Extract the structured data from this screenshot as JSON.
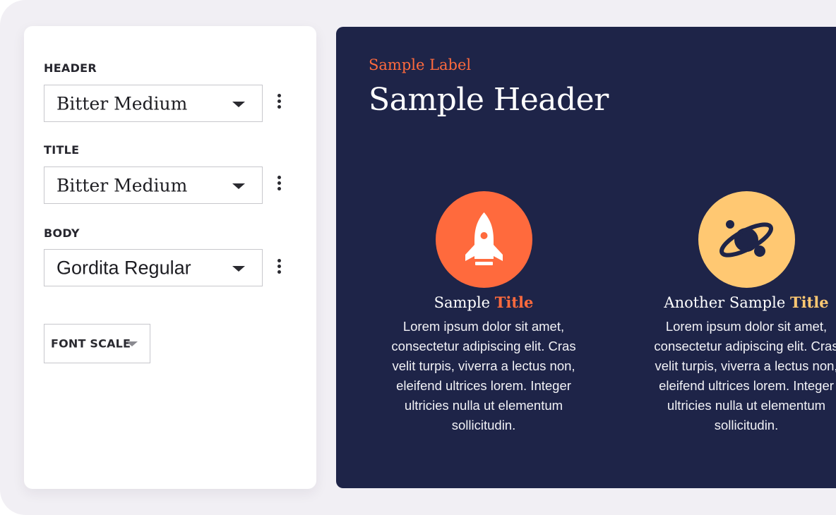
{
  "settings": {
    "header": {
      "label": "HEADER",
      "value": "Bitter Medium"
    },
    "title": {
      "label": "TITLE",
      "value": "Bitter Medium"
    },
    "body": {
      "label": "BODY",
      "value": "Gordita Regular"
    },
    "font_scale_label": "FONT SCALE"
  },
  "preview": {
    "label": "Sample Label",
    "header": "Sample Header",
    "features": [
      {
        "icon": "rocket-icon",
        "title_prefix": "Sample ",
        "title_highlight": "Title",
        "body": "Lorem ipsum dolor sit amet, consectetur adipiscing elit. Cras velit turpis, viverra a lectus non, eleifend ultrices lorem. Integer ultricies nulla ut elementum sollicitudin."
      },
      {
        "icon": "planet-icon",
        "title_prefix": "Another Sample ",
        "title_highlight": "Title",
        "body": "Lorem ipsum dolor sit amet, consectetur adipiscing elit. Cras velit turpis, viverra a lectus non, eleifend ultrices lorem. Integer ultricies nulla ut elementum sollicitudin."
      }
    ]
  },
  "colors": {
    "background": "#f1eff4",
    "preview_bg": "#1e2448",
    "accent_orange": "#ff6a3d",
    "accent_yellow": "#ffc872",
    "text_dark": "#26262e"
  }
}
